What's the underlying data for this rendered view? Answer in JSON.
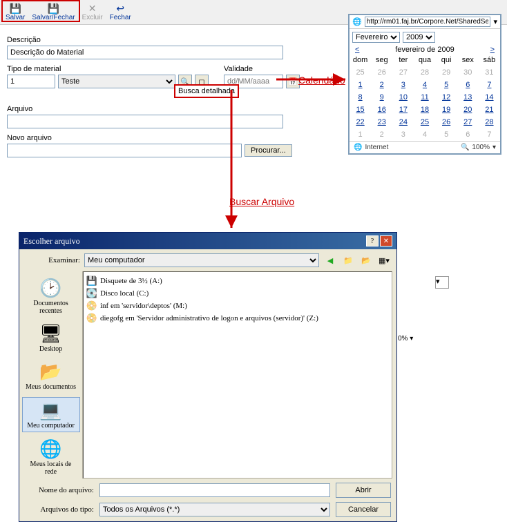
{
  "toolbar": {
    "salvar": "Salvar",
    "salvar_fechar": "Salvar/Fechar",
    "excluir": "Excluir",
    "fechar": "Fechar"
  },
  "form": {
    "descricao_lbl": "Descrição",
    "descricao_val": "Descrição do Material",
    "tipo_lbl": "Tipo de material",
    "tipo_code": "1",
    "tipo_sel": "Teste",
    "validade_lbl": "Validade",
    "validade_ph": "dd/MM/aaaa",
    "busca_detalhada": "Busca detalhada",
    "arquivo_lbl": "Arquivo",
    "arquivo_val": "",
    "novo_lbl": "Novo arquivo",
    "novo_val": "",
    "procurar": "Procurar..."
  },
  "annot": {
    "calendario": "Calendário",
    "buscar_arquivo": "Buscar Arquivo"
  },
  "calendar": {
    "url": "http://rm01.faj.br/Corpore.Net/SharedSer",
    "month_sel": "Fevereiro",
    "year_sel": "2009",
    "title": "fevereiro de 2009",
    "prev": "<",
    "next": ">",
    "dow": [
      "dom",
      "seg",
      "ter",
      "qua",
      "qui",
      "sex",
      "sáb"
    ],
    "rows": [
      [
        {
          "d": "25",
          "dim": true
        },
        {
          "d": "26",
          "dim": true
        },
        {
          "d": "27",
          "dim": true
        },
        {
          "d": "28",
          "dim": true
        },
        {
          "d": "29",
          "dim": true
        },
        {
          "d": "30",
          "dim": true
        },
        {
          "d": "31",
          "dim": true
        }
      ],
      [
        {
          "d": "1"
        },
        {
          "d": "2"
        },
        {
          "d": "3"
        },
        {
          "d": "4"
        },
        {
          "d": "5"
        },
        {
          "d": "6"
        },
        {
          "d": "7"
        }
      ],
      [
        {
          "d": "8"
        },
        {
          "d": "9"
        },
        {
          "d": "10"
        },
        {
          "d": "11"
        },
        {
          "d": "12"
        },
        {
          "d": "13"
        },
        {
          "d": "14"
        }
      ],
      [
        {
          "d": "15"
        },
        {
          "d": "16"
        },
        {
          "d": "17"
        },
        {
          "d": "18"
        },
        {
          "d": "19"
        },
        {
          "d": "20"
        },
        {
          "d": "21"
        }
      ],
      [
        {
          "d": "22"
        },
        {
          "d": "23"
        },
        {
          "d": "24"
        },
        {
          "d": "25"
        },
        {
          "d": "26"
        },
        {
          "d": "27"
        },
        {
          "d": "28"
        }
      ],
      [
        {
          "d": "1",
          "dim": true
        },
        {
          "d": "2",
          "dim": true
        },
        {
          "d": "3",
          "dim": true
        },
        {
          "d": "4",
          "dim": true
        },
        {
          "d": "5",
          "dim": true
        },
        {
          "d": "6",
          "dim": true
        },
        {
          "d": "7",
          "dim": true
        }
      ]
    ],
    "zone": "Internet",
    "zoom": "100%"
  },
  "dialog": {
    "title": "Escolher arquivo",
    "examinar_lbl": "Examinar:",
    "examinar_val": "Meu computador",
    "places": [
      {
        "label": "Documentos recentes",
        "icon": "🕑"
      },
      {
        "label": "Desktop",
        "icon": "🖥"
      },
      {
        "label": "Meus documentos",
        "icon": "📂"
      },
      {
        "label": "Meu computador",
        "icon": "💻",
        "sel": true
      },
      {
        "label": "Meus locais de rede",
        "icon": "🌐"
      }
    ],
    "files": [
      {
        "icon": "💾",
        "label": "Disquete de 3½ (A:)"
      },
      {
        "icon": "💽",
        "label": "Disco local (C:)"
      },
      {
        "icon": "📀",
        "label": "inf em 'servidor\\deptos' (M:)"
      },
      {
        "icon": "📀",
        "label": "diegofg em 'Servidor administrativo de logon e arquivos (servidor)' (Z:)"
      }
    ],
    "nome_lbl": "Nome do arquivo:",
    "nome_val": "",
    "tipo_lbl": "Arquivos do tipo:",
    "tipo_val": "Todos os Arquivos (*.*)",
    "abrir": "Abrir",
    "cancelar": "Cancelar"
  },
  "behind": {
    "zoom2": "0%  ▾"
  }
}
